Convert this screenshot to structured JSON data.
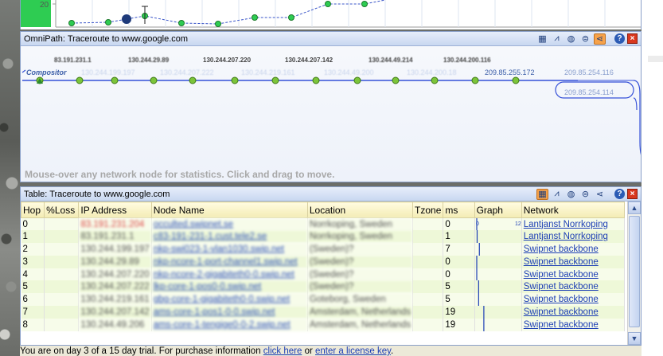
{
  "omnipath": {
    "title": "OmniPath: Traceroute to www.google.com",
    "hint": "Mouse-over any network node for statistics. Click and drag to move.",
    "route_label": "Compositor",
    "hop_ips": [
      "83.191.231.1",
      "130.244.29.89",
      "130.244.207.220",
      "130.244.207.142",
      "130.244.49.214",
      "130.244.200.116"
    ],
    "network_labels": [
      "130.244.199.197",
      "130.244.207.222",
      "130.244.219.161",
      "130.244.49.200",
      "130.244.200.18",
      "209.85.255.172",
      "209.85.254.116",
      "209.85.254.114"
    ]
  },
  "table": {
    "title": "Table: Traceroute to www.google.com",
    "columns": [
      "Hop",
      "%Loss",
      "IP Address",
      "Node Name",
      "Location",
      "Tzone",
      "ms",
      "Graph",
      "Network"
    ],
    "graph_scale": {
      "min": "0",
      "max": "128"
    },
    "rows": [
      {
        "hop": "0",
        "loss": "",
        "ip": "83.191.231.204",
        "node": "occulted.swipnet.se",
        "location": "Norrkoping, Sweden",
        "tzone": "",
        "ms": "0",
        "network": "Lantjanst Norrkoping"
      },
      {
        "hop": "1",
        "loss": "",
        "ip": "83.191.231.1",
        "node": "c83-191-231-1.cust.tele2.se",
        "location": "Norrkoping, Sweden",
        "tzone": "",
        "ms": "1",
        "network": "Lantjanst Norrkoping"
      },
      {
        "hop": "2",
        "loss": "",
        "ip": "130.244.199.197",
        "node": "nkp-swi023-1-vlan1030.swip.net",
        "location": "(Sweden)?",
        "tzone": "",
        "ms": "7",
        "network": "Swipnet backbone"
      },
      {
        "hop": "3",
        "loss": "",
        "ip": "130.244.29.89",
        "node": "nkp-ncore-1-port-channel1.swip.net",
        "location": "(Sweden)?",
        "tzone": "",
        "ms": "0",
        "network": "Swipnet backbone"
      },
      {
        "hop": "4",
        "loss": "",
        "ip": "130.244.207.220",
        "node": "nkp-ncore-2-gigabiteth0-0.swip.net",
        "location": "(Sweden)?",
        "tzone": "",
        "ms": "0",
        "network": "Swipnet backbone"
      },
      {
        "hop": "5",
        "loss": "",
        "ip": "130.244.207.222",
        "node": "lkp-core-1-pos0-0.swip.net",
        "location": "(Sweden)?",
        "tzone": "",
        "ms": "5",
        "network": "Swipnet backbone"
      },
      {
        "hop": "6",
        "loss": "",
        "ip": "130.244.219.161",
        "node": "gbg-core-1-gigabiteth0-0.swip.net",
        "location": "Goteborg, Sweden",
        "tzone": "",
        "ms": "5",
        "network": "Swipnet backbone"
      },
      {
        "hop": "7",
        "loss": "",
        "ip": "130.244.207.142",
        "node": "ams-core-1-pos1-0-0.swip.net",
        "location": "Amsterdam, Netherlands",
        "tzone": "",
        "ms": "19",
        "network": "Swipnet backbone"
      },
      {
        "hop": "8",
        "loss": "",
        "ip": "130.244.49.206",
        "node": "ams-core-1-tengige0-0-2.swip.net",
        "location": "Amsterdam, Netherlands",
        "tzone": "",
        "ms": "19",
        "network": "Swipnet backbone"
      }
    ]
  },
  "chart_top": {
    "ytick": "20"
  },
  "statusbar": {
    "prefix": "You are on day 3 of a 15 day trial. For purchase information ",
    "link1": "click here",
    "middle": " or ",
    "link2": "enter a license key",
    "suffix": "."
  },
  "colors": {
    "accent": "#2b5bb4",
    "node_green": "#7cc43a",
    "route_blue": "#3550d8"
  }
}
